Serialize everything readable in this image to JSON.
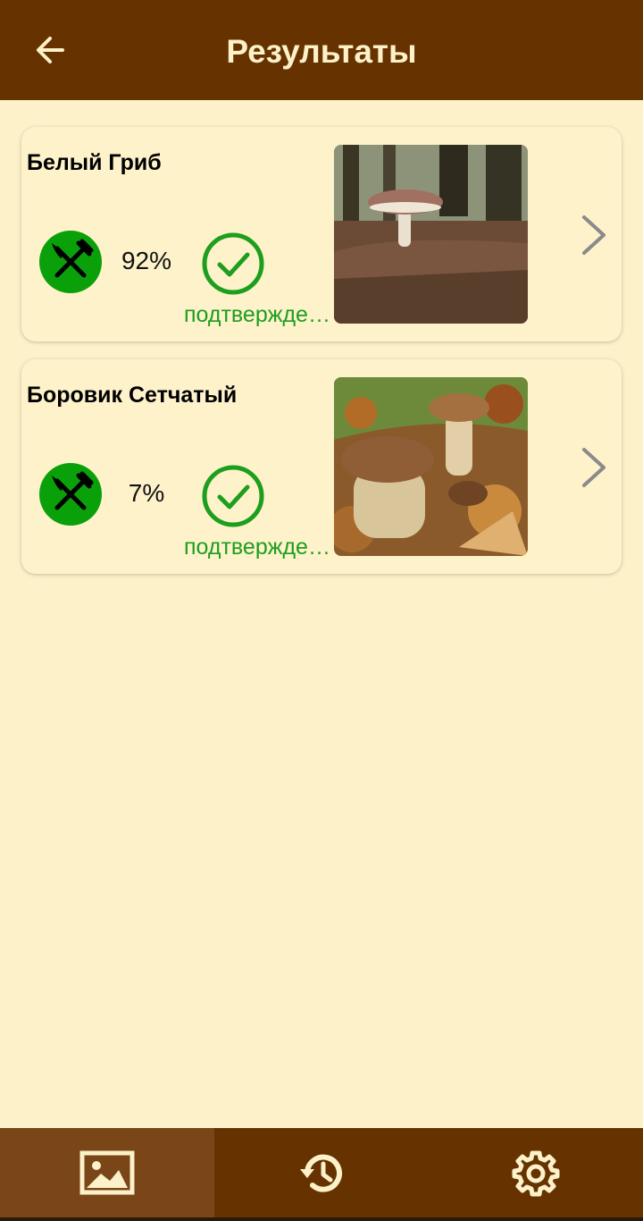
{
  "header": {
    "title": "Результаты",
    "back_icon": "arrow-left-icon"
  },
  "results": [
    {
      "name": "Белый Гриб",
      "percent": "92%",
      "edible_icon": "fork-knife-icon",
      "confirmed_icon": "check-circle-icon",
      "status": "подтвержде…",
      "image": "mushroom-photo",
      "chevron_icon": "chevron-right-icon"
    },
    {
      "name": "Боровик Сетчатый",
      "percent": "7%",
      "edible_icon": "fork-knife-icon",
      "confirmed_icon": "check-circle-icon",
      "status": "подтвержде…",
      "image": "mushroom-photo",
      "chevron_icon": "chevron-right-icon"
    }
  ],
  "bottom_nav": {
    "items": [
      {
        "icon": "image-icon",
        "active": true
      },
      {
        "icon": "history-icon",
        "active": false
      },
      {
        "icon": "settings-gear-icon",
        "active": false
      }
    ]
  },
  "colors": {
    "header_bg": "#663300",
    "page_bg": "#FCF1C9",
    "header_text": "#FCF1C9",
    "edible_green": "#0AA00A",
    "status_green": "#1E9E1E",
    "active_tab": "#7A4517"
  }
}
